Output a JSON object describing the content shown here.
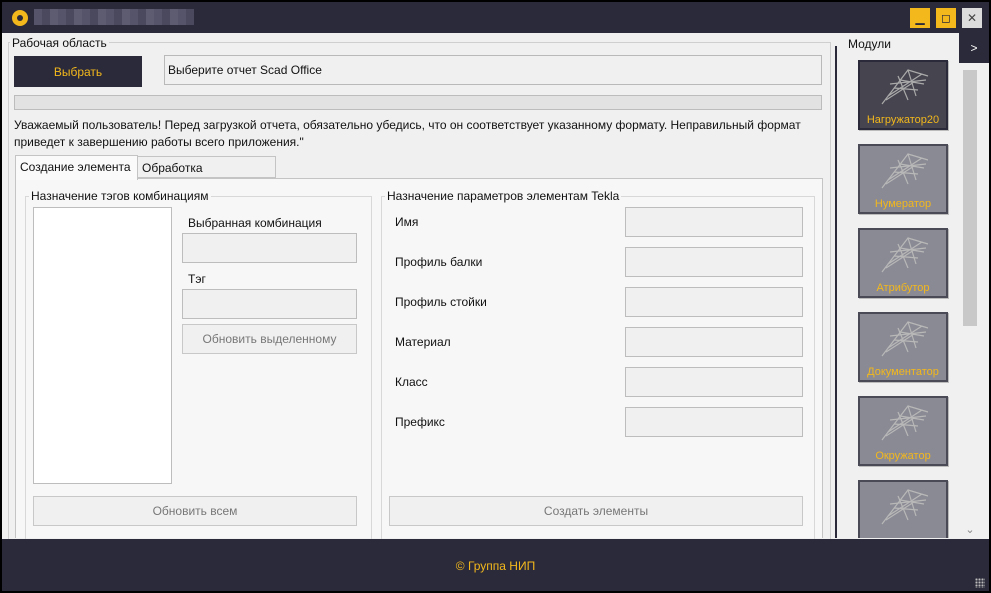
{
  "window": {
    "controls": {
      "minimize_glyph": "▁",
      "maximize_glyph": "◻",
      "close_glyph": "✕"
    }
  },
  "workspace": {
    "label": "Рабочая область",
    "select_button": "Выбрать",
    "report_field_text": "Выберите отчет Scad Office",
    "progress_value": 0,
    "warning": "Уважаемый пользователь! Перед загрузкой отчета, обязательно убедись, что он соответствует указанному формату. Неправильный формат приведет к завершению работы всего приложения.\""
  },
  "tabs": [
    {
      "label": "Создание элемента",
      "active": true
    },
    {
      "label": "Обработка результатов",
      "active": false
    }
  ],
  "combination_tags": {
    "label": "Назначение тэгов комбинациям",
    "selected_combination_label": "Выбранная комбинация",
    "selected_combination_value": "",
    "tag_label": "Тэг",
    "tag_value": "",
    "update_selected_button": "Обновить выделенному",
    "update_all_button": "Обновить всем"
  },
  "tekla_params": {
    "label": "Назначение параметров элементам Tekla",
    "fields": [
      {
        "label": "Имя",
        "value": ""
      },
      {
        "label": "Профиль балки",
        "value": ""
      },
      {
        "label": "Профиль стойки",
        "value": ""
      },
      {
        "label": "Материал",
        "value": ""
      },
      {
        "label": "Класс",
        "value": ""
      },
      {
        "label": "Префикс",
        "value": ""
      }
    ],
    "create_button": "Создать элементы"
  },
  "modules": {
    "label": "Модули",
    "collapse_glyph": ">",
    "items": [
      {
        "name": "Нагружатор20",
        "active": true,
        "icon": "frame-structure-icon"
      },
      {
        "name": "Нумератор",
        "active": false,
        "icon": "frame-structure-icon"
      },
      {
        "name": "Атрибутор",
        "active": false,
        "icon": "frame-structure-icon"
      },
      {
        "name": "Документатор",
        "active": false,
        "icon": "frame-structure-icon"
      },
      {
        "name": "Окружатор",
        "active": false,
        "icon": "frame-structure-icon"
      },
      {
        "name": "",
        "active": false,
        "icon": "frame-structure-icon"
      }
    ],
    "scroll_down_glyph": "⌄"
  },
  "footer": {
    "text": "© Группа НИП"
  },
  "colors": {
    "dark": "#2b2a3a",
    "accent": "#f3b81c",
    "background": "#f0f0f0"
  }
}
